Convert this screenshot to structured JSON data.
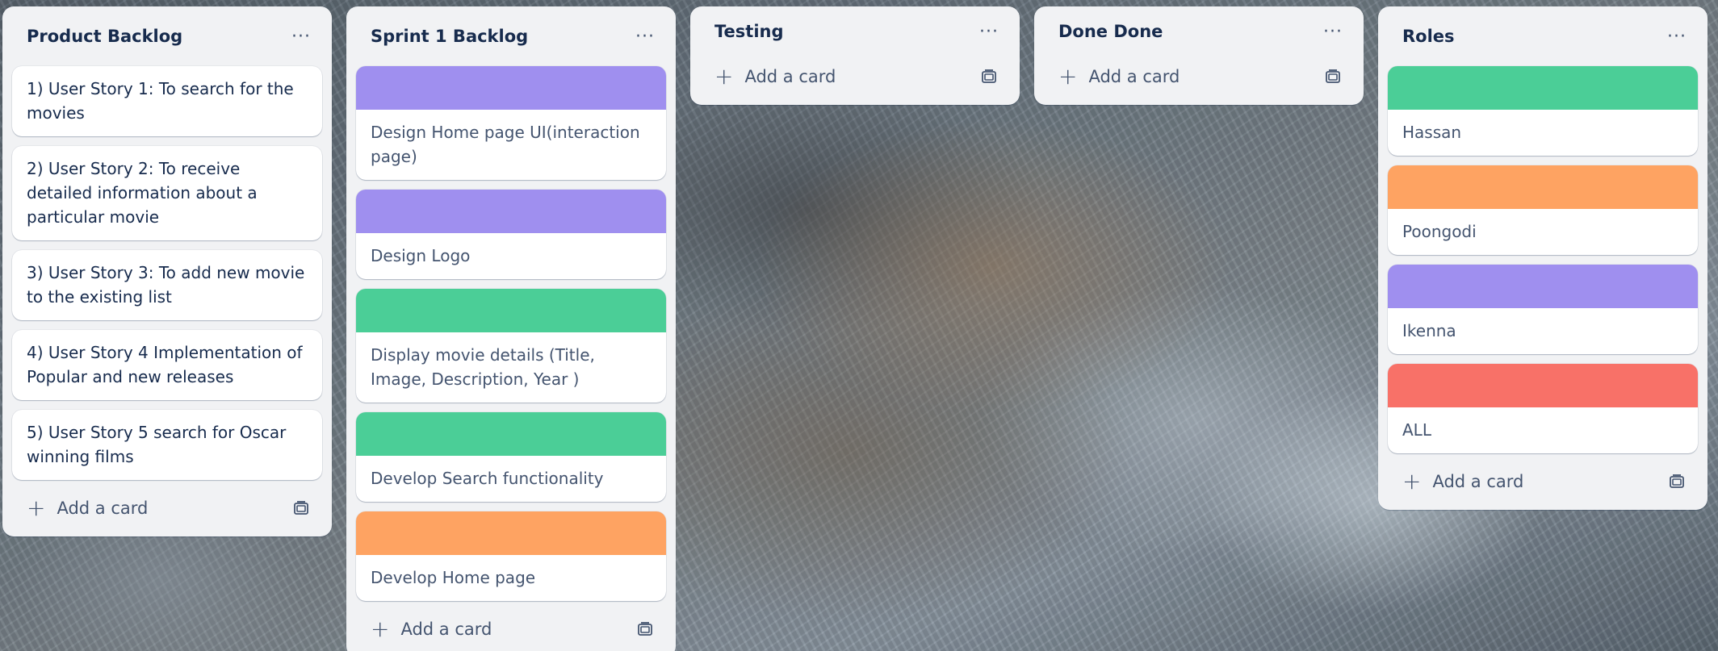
{
  "colors": {
    "purple": "#9f8fef",
    "green": "#4bce97",
    "orange": "#fea362",
    "red": "#f87168",
    "list_bg": "#f1f2f4"
  },
  "common": {
    "add_card_label": "Add a card",
    "menu_glyph": "···",
    "plus_glyph": "+"
  },
  "lists": [
    {
      "title": "Product Backlog",
      "cards": [
        {
          "text": "1) User Story 1: To search for the movies"
        },
        {
          "text": "2) User Story 2: To receive detailed information about a particular movie"
        },
        {
          "text": "3) User Story 3: To add new movie to the existing list"
        },
        {
          "text": "4) User Story 4 Implementation of Popular and new releases"
        },
        {
          "text": "5) User Story 5 search for Oscar winning films"
        }
      ]
    },
    {
      "title": "Sprint 1 Backlog",
      "cards": [
        {
          "cover": "purple",
          "text": "Design Home page UI(interaction page)"
        },
        {
          "cover": "purple",
          "text": "Design Logo"
        },
        {
          "cover": "green",
          "text": "Display movie details (Title, Image, Description, Year )"
        },
        {
          "cover": "green",
          "text": "Develop Search functionality"
        },
        {
          "cover": "orange",
          "text": "Develop Home page"
        }
      ]
    },
    {
      "title": "Testing",
      "cards": []
    },
    {
      "title": "Done Done",
      "cards": []
    },
    {
      "title": "Roles",
      "cards": [
        {
          "cover": "green",
          "text": "Hassan"
        },
        {
          "cover": "orange",
          "text": "Poongodi"
        },
        {
          "cover": "purple",
          "text": "Ikenna"
        },
        {
          "cover": "red",
          "text": "ALL"
        }
      ]
    }
  ]
}
